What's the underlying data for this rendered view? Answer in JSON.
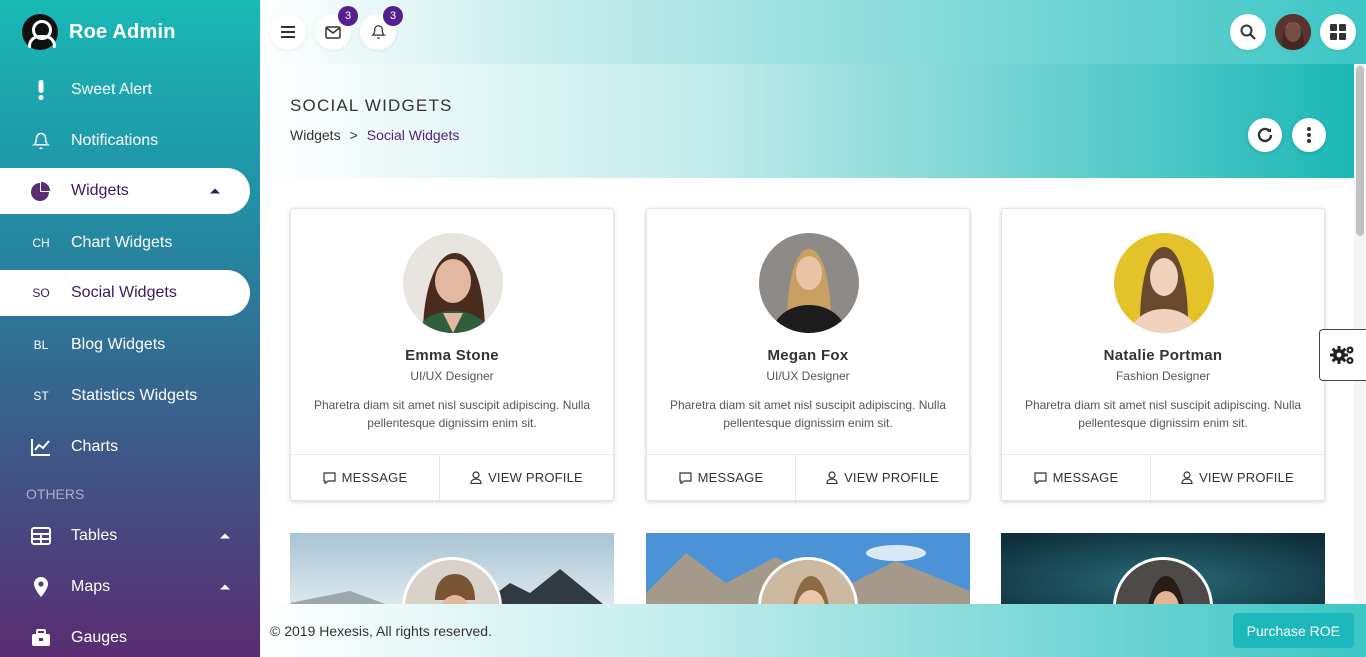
{
  "brand": {
    "name": "Roe Admin"
  },
  "sidebar": {
    "items": [
      {
        "label": "Sweet Alert",
        "icon": "exclamation-icon"
      },
      {
        "label": "Notifications",
        "icon": "bell-icon"
      },
      {
        "label": "Widgets",
        "icon": "pie-chart-icon",
        "active": true
      },
      {
        "abbr": "CH",
        "label": "Chart Widgets"
      },
      {
        "abbr": "SO",
        "label": "Social Widgets",
        "active": true
      },
      {
        "abbr": "BL",
        "label": "Blog Widgets"
      },
      {
        "abbr": "ST",
        "label": "Statistics Widgets"
      },
      {
        "label": "Charts",
        "icon": "line-chart-icon"
      }
    ],
    "section_others": "OTHERS",
    "others": [
      {
        "label": "Tables",
        "icon": "table-icon"
      },
      {
        "label": "Maps",
        "icon": "map-pin-icon"
      },
      {
        "label": "Gauges",
        "icon": "toolbox-icon"
      }
    ]
  },
  "topbar": {
    "messages_count": "3",
    "notifications_count": "3"
  },
  "page": {
    "title": "SOCIAL WIDGETS",
    "breadcrumb": {
      "root": "Widgets",
      "separator": ">",
      "current": "Social Widgets"
    }
  },
  "cards": [
    {
      "name": "Emma Stone",
      "role": "UI/UX Designer",
      "desc": "Pharetra diam sit amet nisl suscipit adipiscing. Nulla pellentesque dignissim enim sit.",
      "message": "MESSAGE",
      "profile": "VIEW PROFILE"
    },
    {
      "name": "Megan Fox",
      "role": "UI/UX Designer",
      "desc": "Pharetra diam sit amet nisl suscipit adipiscing. Nulla pellentesque dignissim enim sit.",
      "message": "MESSAGE",
      "profile": "VIEW PROFILE"
    },
    {
      "name": "Natalie Portman",
      "role": "Fashion Designer",
      "desc": "Pharetra diam sit amet nisl suscipit adipiscing. Nulla pellentesque dignissim enim sit.",
      "message": "MESSAGE",
      "profile": "VIEW PROFILE"
    }
  ],
  "footer": {
    "copyright": "© 2019 Hexesis, All rights reserved.",
    "purchase": "Purchase ROE"
  },
  "colors": {
    "accent": "#1cb8bb",
    "purple": "#53208f",
    "sidebar_top": "#18b9b5",
    "sidebar_bottom": "#5a2c72"
  }
}
